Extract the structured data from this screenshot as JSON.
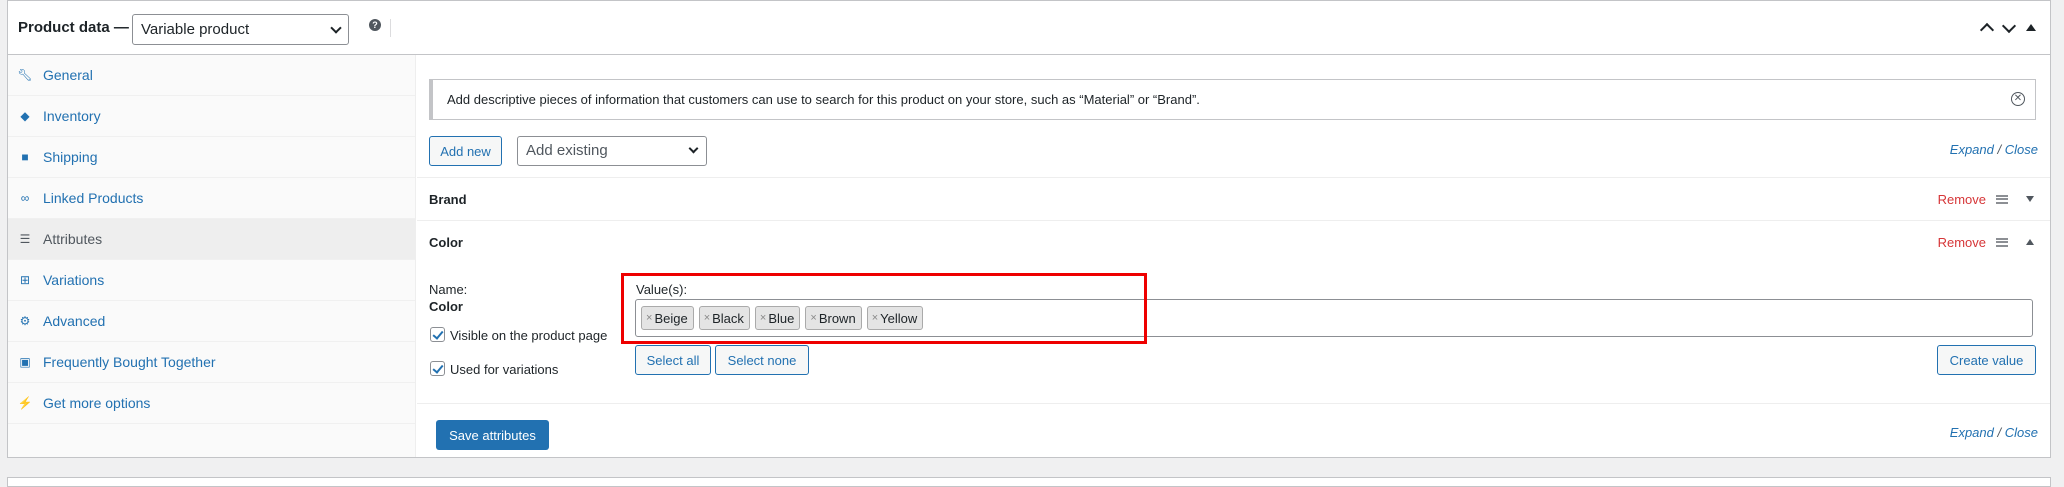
{
  "header": {
    "title": "Product data —",
    "product_type": "Variable product"
  },
  "sidebar": {
    "items": [
      {
        "label": "General",
        "icon": "wrench-icon"
      },
      {
        "label": "Inventory",
        "icon": "tag-icon"
      },
      {
        "label": "Shipping",
        "icon": "truck-icon"
      },
      {
        "label": "Linked Products",
        "icon": "link-icon"
      },
      {
        "label": "Attributes",
        "icon": "list-icon",
        "active": true
      },
      {
        "label": "Variations",
        "icon": "grid-icon"
      },
      {
        "label": "Advanced",
        "icon": "gear-icon"
      },
      {
        "label": "Frequently Bought Together",
        "icon": "lock-icon"
      },
      {
        "label": "Get more options",
        "icon": "plug-icon"
      }
    ]
  },
  "main": {
    "notice": "Add descriptive pieces of information that customers can use to search for this product on your store, such as “Material” or “Brand”.",
    "add_new": "Add new",
    "add_existing_placeholder": "Add existing",
    "expand": "Expand",
    "slash": "/",
    "close": "Close",
    "attributes": [
      {
        "name": "Brand",
        "remove": "Remove",
        "expanded": false
      },
      {
        "name": "Color",
        "remove": "Remove",
        "expanded": true
      }
    ],
    "color_detail": {
      "name_label": "Name:",
      "name_value": "Color",
      "values_label": "Value(s):",
      "values": [
        "Beige",
        "Black",
        "Blue",
        "Brown",
        "Yellow"
      ],
      "visible_label": "Visible on the product page",
      "variations_label": "Used for variations",
      "select_all": "Select all",
      "select_none": "Select none",
      "create_value": "Create value"
    },
    "save_attributes": "Save attributes"
  },
  "colors": {
    "accent": "#2271b1",
    "remove": "#d63638",
    "highlight": "#e00000"
  }
}
